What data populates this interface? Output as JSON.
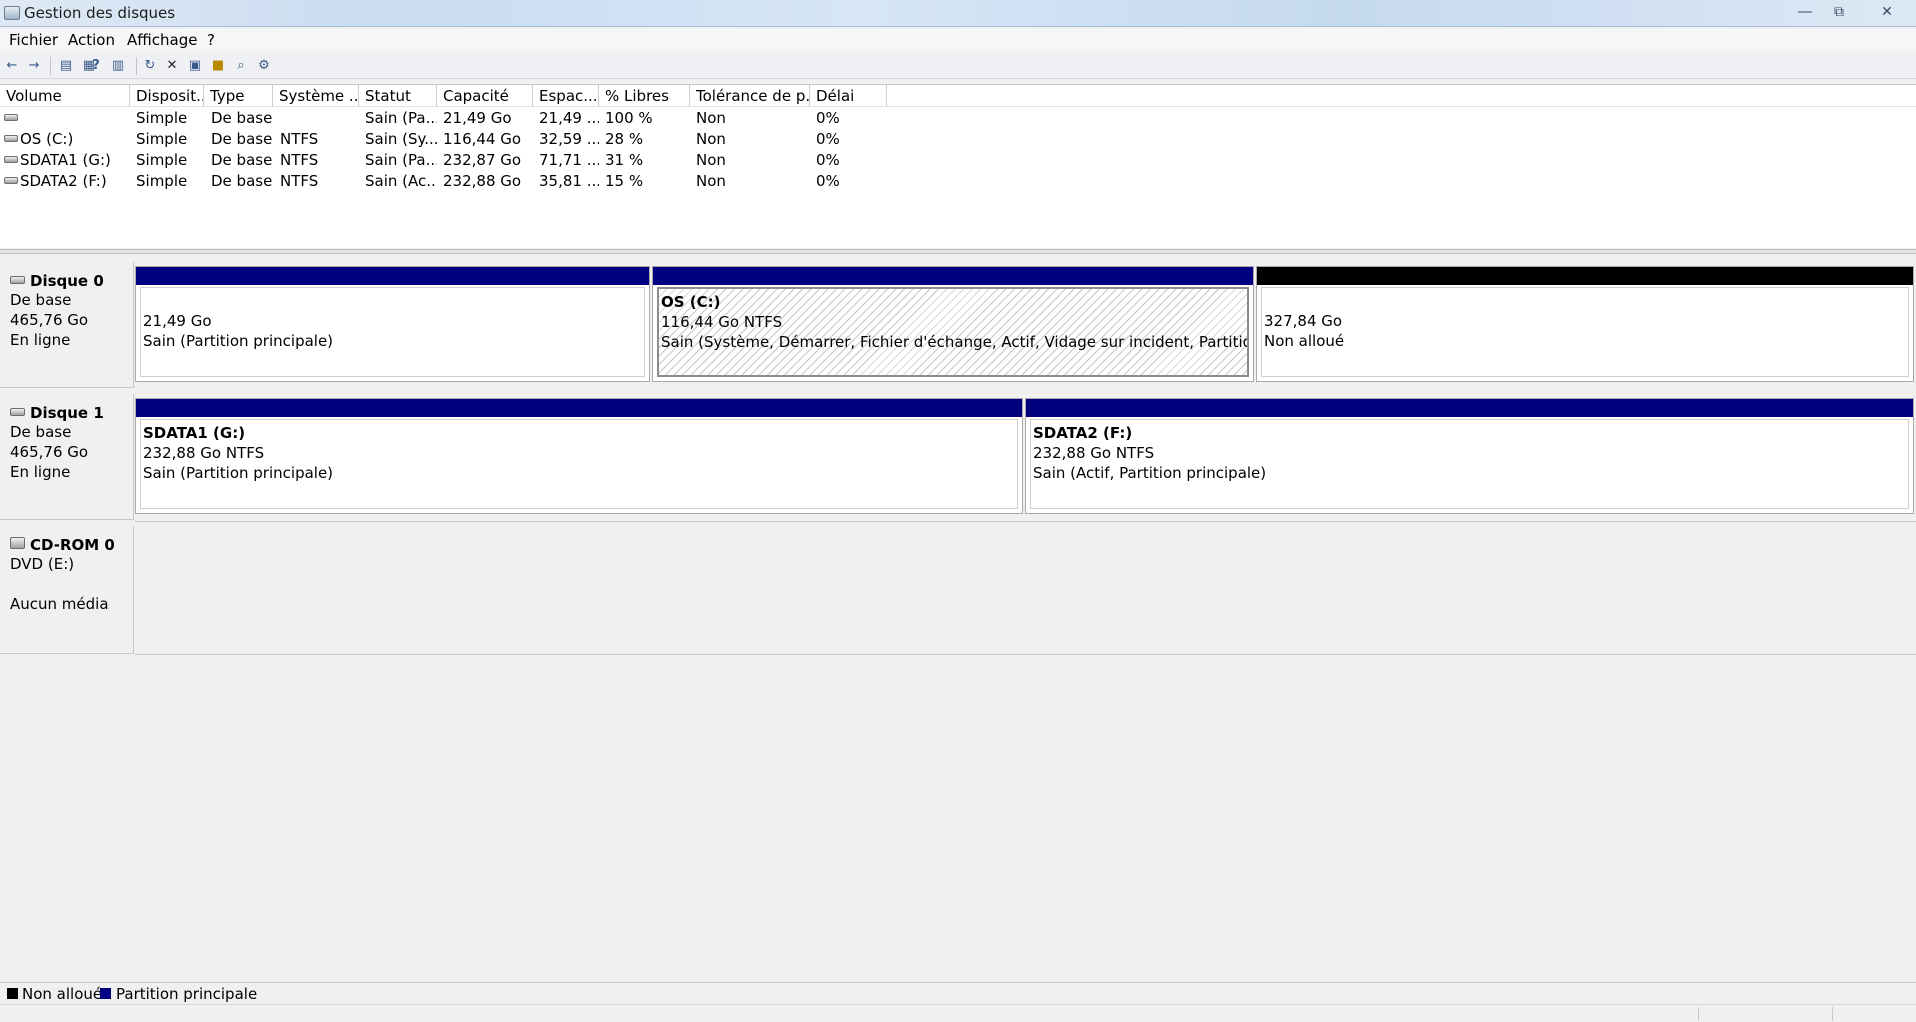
{
  "window": {
    "title": "Gestion des disques"
  },
  "menu": [
    "Fichier",
    "Action",
    "Affichage",
    "?"
  ],
  "toolbar": [
    "back-arrow-icon",
    "forward-arrow-icon",
    "up-list-icon",
    "properties-list-icon",
    "help-icon",
    "console-icon",
    "refresh-icon",
    "delete-icon",
    "properties-icon",
    "open-folder-icon",
    "search-icon",
    "settings-icon"
  ],
  "volumes": {
    "columns": [
      "Volume",
      "Disposit...",
      "Type",
      "Système ...",
      "Statut",
      "Capacité",
      "Espac...",
      "% Libres",
      "Tolérance de p...",
      "Délai"
    ],
    "rows": [
      {
        "volume": "",
        "layout": "Simple",
        "type": "De base",
        "fs": "",
        "status": "Sain (Pa...",
        "capacity": "21,49 Go",
        "free": "21,49 ...",
        "pct": "100 %",
        "fault": "Non",
        "overhead": "0%"
      },
      {
        "volume": "OS (C:)",
        "layout": "Simple",
        "type": "De base",
        "fs": "NTFS",
        "status": "Sain (Sy...",
        "capacity": "116,44 Go",
        "free": "32,59 ...",
        "pct": "28 %",
        "fault": "Non",
        "overhead": "0%"
      },
      {
        "volume": "SDATA1 (G:)",
        "layout": "Simple",
        "type": "De base",
        "fs": "NTFS",
        "status": "Sain (Pa...",
        "capacity": "232,87 Go",
        "free": "71,71 ...",
        "pct": "31 %",
        "fault": "Non",
        "overhead": "0%"
      },
      {
        "volume": "SDATA2 (F:)",
        "layout": "Simple",
        "type": "De base",
        "fs": "NTFS",
        "status": "Sain (Ac...",
        "capacity": "232,88 Go",
        "free": "35,81 ...",
        "pct": "15 %",
        "fault": "Non",
        "overhead": "0%"
      }
    ]
  },
  "disks": [
    {
      "name": "Disque 0",
      "kind": "De base",
      "size": "465,76 Go",
      "state": "En ligne",
      "partitions": [
        {
          "title": "",
          "size": "21,49 Go",
          "status": "Sain (Partition principale)"
        },
        {
          "title": "OS  (C:)",
          "size": "116,44 Go NTFS",
          "status": "Sain (Système, Démarrer, Fichier d'échange, Actif, Vidage sur incident, Partition principale)"
        },
        {
          "title": "",
          "size": "327,84 Go",
          "status": "Non alloué"
        }
      ]
    },
    {
      "name": "Disque 1",
      "kind": "De base",
      "size": "465,76 Go",
      "state": "En ligne",
      "partitions": [
        {
          "title": "SDATA1  (G:)",
          "size": "232,88 Go NTFS",
          "status": "Sain (Partition principale)"
        },
        {
          "title": "SDATA2  (F:)",
          "size": "232,88 Go NTFS",
          "status": "Sain (Actif, Partition principale)"
        }
      ]
    }
  ],
  "cdrom": {
    "name": "CD-ROM 0",
    "drive": "DVD (E:)",
    "media": "Aucun média"
  },
  "legend": [
    {
      "label": "Non alloué",
      "color": "#000000"
    },
    {
      "label": "Partition principale",
      "color": "#000080"
    }
  ]
}
